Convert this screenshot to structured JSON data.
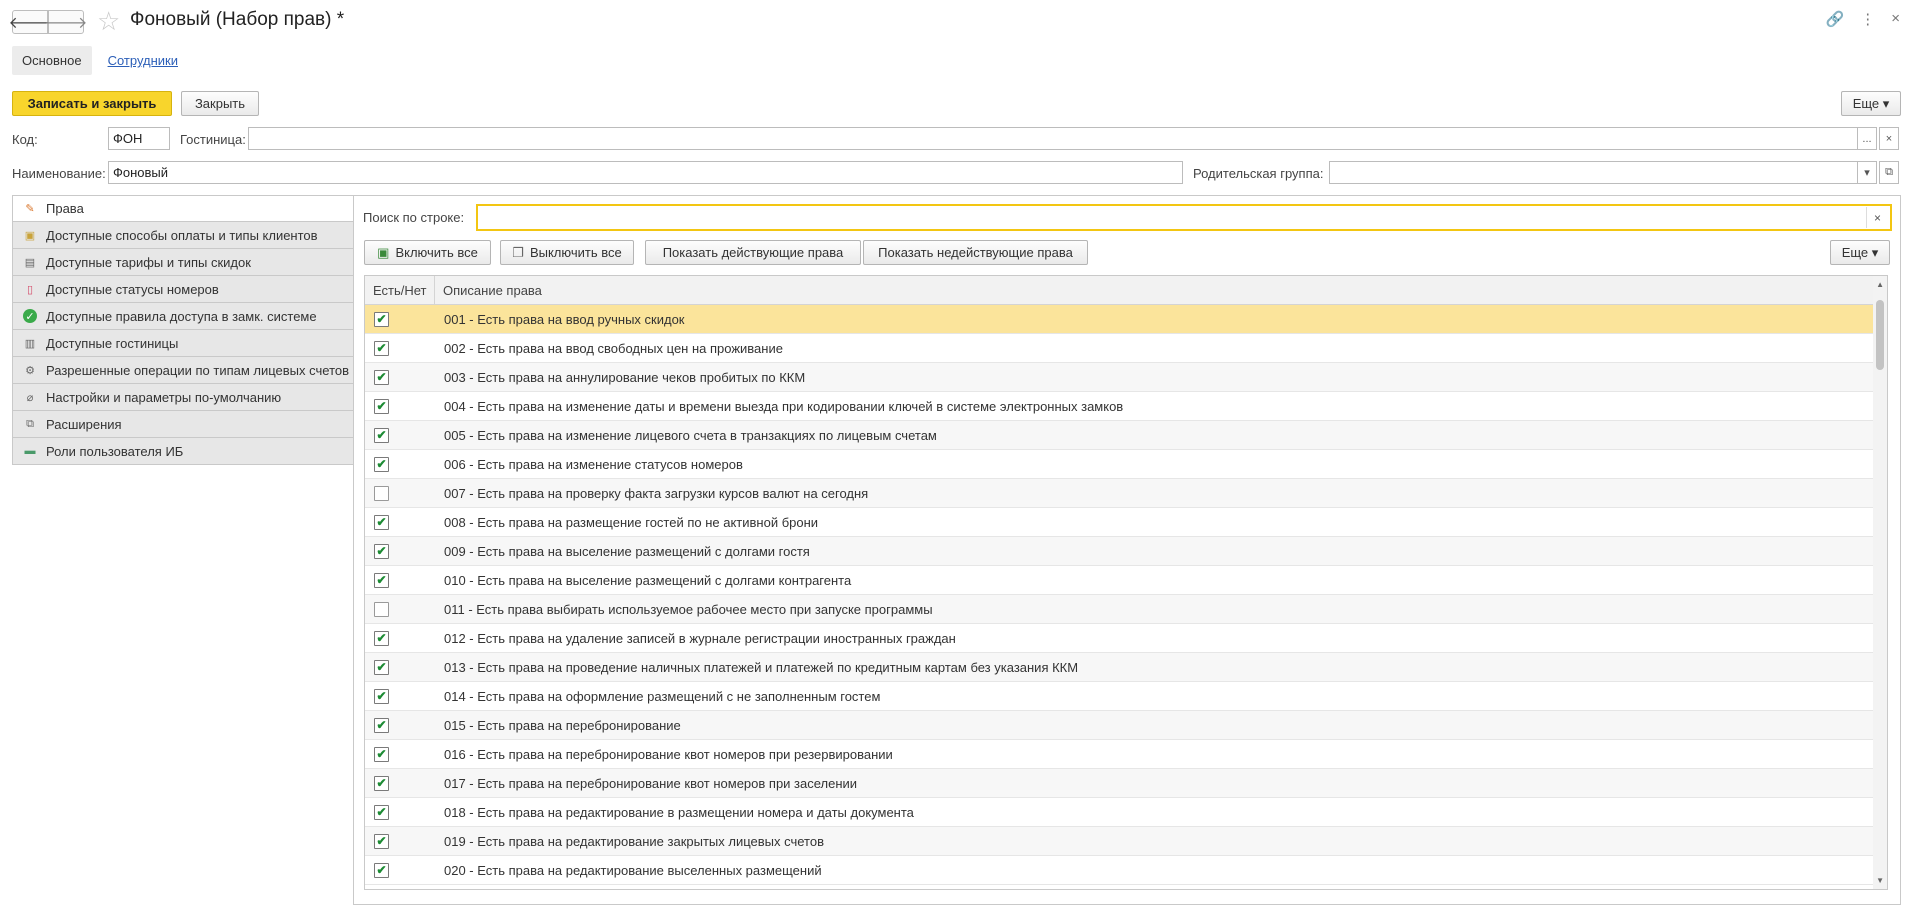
{
  "window": {
    "title": "Фоновый (Набор прав) *",
    "back_icon": "🡐",
    "forward_icon": "🡒",
    "star_icon": "☆",
    "link_icon": "🔗",
    "more_icon": "⋮",
    "close_icon": "×"
  },
  "tabs": [
    {
      "label": "Основное"
    },
    {
      "label": "Сотрудники"
    }
  ],
  "toolbar": {
    "save_close": "Записать и закрыть",
    "close": "Закрыть",
    "more": "Еще ▾"
  },
  "form": {
    "code_label": "Код:",
    "code_value": "ФОН",
    "hotel_label": "Гостиница:",
    "hotel_value": "",
    "hotel_choose": "...",
    "hotel_clear": "×",
    "name_label": "Наименование:",
    "name_value": "Фоновый",
    "parent_label": "Родительская группа:",
    "parent_value": "",
    "parent_dropdown": "▾",
    "parent_open": "⧉"
  },
  "sidebar": {
    "items": [
      {
        "label": "Права",
        "icon": "rights-icon",
        "glyph": "✎"
      },
      {
        "label": "Доступные способы оплаты и типы клиентов",
        "icon": "payment-icon",
        "glyph": "▣"
      },
      {
        "label": "Доступные тарифы и типы скидок",
        "icon": "tariff-icon",
        "glyph": "▤"
      },
      {
        "label": "Доступные статусы номеров",
        "icon": "room-status-icon",
        "glyph": "▯"
      },
      {
        "label": "Доступные правила доступа в замк. системе",
        "icon": "access-check-icon",
        "glyph": "✓"
      },
      {
        "label": "Доступные гостиницы",
        "icon": "hotel-icon",
        "glyph": "▥"
      },
      {
        "label": "Разрешенные операции по типам лицевых счетов",
        "icon": "gear-icon",
        "glyph": "⚙"
      },
      {
        "label": "Настройки и параметры по-умолчанию",
        "icon": "paperclip-icon",
        "glyph": "⌀"
      },
      {
        "label": "Расширения",
        "icon": "extensions-icon",
        "glyph": "⧉"
      },
      {
        "label": "Роли пользователя ИБ",
        "icon": "roles-icon",
        "glyph": "▬"
      }
    ]
  },
  "rights": {
    "search_label": "Поиск по строке:",
    "search_value": "",
    "search_clear": "×",
    "enable_all": "Включить все",
    "disable_all": "Выключить все",
    "show_active": "Показать действующие права",
    "show_inactive": "Показать недействующие права",
    "more": "Еще ▾",
    "columns": [
      "Есть/Нет",
      "Описание права"
    ],
    "check_glyph": "✔",
    "rows": [
      {
        "checked": true,
        "text": "001 - Есть права на ввод ручных скидок"
      },
      {
        "checked": true,
        "text": "002 - Есть права на ввод свободных цен на проживание"
      },
      {
        "checked": true,
        "text": "003 - Есть права на аннулирование чеков пробитых по ККМ"
      },
      {
        "checked": true,
        "text": "004 - Есть права на изменение даты и времени выезда при кодировании ключей в системе электронных замков"
      },
      {
        "checked": true,
        "text": "005 - Есть права на изменение лицевого счета в транзакциях по лицевым счетам"
      },
      {
        "checked": true,
        "text": "006 - Есть права на изменение статусов номеров"
      },
      {
        "checked": false,
        "text": "007 - Есть права на проверку факта загрузки курсов валют на сегодня"
      },
      {
        "checked": true,
        "text": "008 - Есть права на размещение гостей по не активной брони"
      },
      {
        "checked": true,
        "text": "009 - Есть права на выселение размещений с долгами гостя"
      },
      {
        "checked": true,
        "text": "010 - Есть права на выселение размещений с долгами контрагента"
      },
      {
        "checked": false,
        "text": "011 - Есть права выбирать используемое рабочее место при запуске программы"
      },
      {
        "checked": true,
        "text": "012 - Есть права на удаление записей в журнале регистрации иностранных граждан"
      },
      {
        "checked": true,
        "text": "013 - Есть права на проведение наличных платежей и платежей по кредитным картам без указания ККМ"
      },
      {
        "checked": true,
        "text": "014 - Есть права на оформление размещений с не заполненным гостем"
      },
      {
        "checked": true,
        "text": "015 - Есть права на перебронирование"
      },
      {
        "checked": true,
        "text": "016 - Есть права на перебронирование квот номеров при резервировании"
      },
      {
        "checked": true,
        "text": "017 - Есть права на перебронирование квот номеров при заселении"
      },
      {
        "checked": true,
        "text": "018 - Есть права на редактирование в размещении номера и даты документа"
      },
      {
        "checked": true,
        "text": "019 - Есть права на редактирование закрытых лицевых счетов"
      },
      {
        "checked": true,
        "text": "020 - Есть права на редактирование выселенных размещений"
      }
    ]
  },
  "colors": {
    "accent": "#f8d52c",
    "selected_row": "#fbe49b",
    "link": "#2c5fb8",
    "check": "#1d8b34"
  }
}
